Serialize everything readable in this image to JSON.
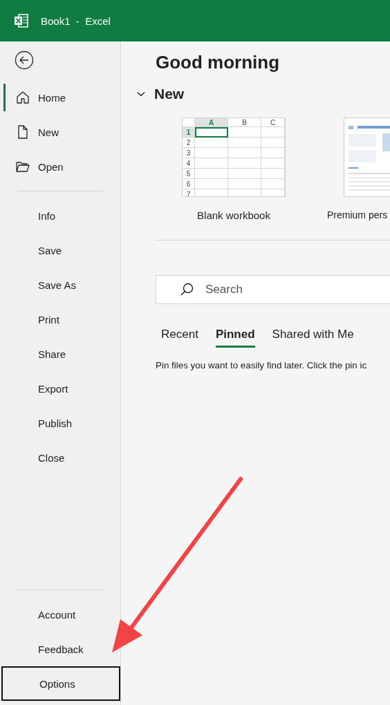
{
  "window": {
    "title": "Book1  -  Excel"
  },
  "sidebar": {
    "sections": [
      {
        "items": [
          {
            "label": "Home",
            "selected": true
          },
          {
            "label": "New",
            "selected": false
          },
          {
            "label": "Open",
            "selected": false
          }
        ]
      },
      {
        "items": [
          {
            "label": "Info",
            "selected": false
          },
          {
            "label": "Save",
            "selected": false
          },
          {
            "label": "Save As",
            "selected": false
          },
          {
            "label": "Print",
            "selected": false
          },
          {
            "label": "Share",
            "selected": false
          },
          {
            "label": "Export",
            "selected": false
          },
          {
            "label": "Publish",
            "selected": false
          },
          {
            "label": "Close",
            "selected": false
          }
        ]
      },
      {
        "items": [
          {
            "label": "Account",
            "selected": false
          },
          {
            "label": "Feedback",
            "selected": false
          },
          {
            "label": "Options",
            "selected": false,
            "outlined": true
          }
        ]
      }
    ]
  },
  "greeting": "Good morning",
  "new_section": {
    "title": "New",
    "expanded": true,
    "templates": [
      {
        "kind": "blank",
        "label": "Blank workbook",
        "columns": [
          "A",
          "B",
          "C"
        ],
        "rows": [
          "1",
          "2",
          "3",
          "4",
          "5",
          "6",
          "7"
        ]
      },
      {
        "kind": "preview",
        "label": "Premium pers"
      }
    ]
  },
  "search": {
    "placeholder": "Search"
  },
  "tabs": [
    {
      "label": "Recent",
      "selected": false
    },
    {
      "label": "Pinned",
      "selected": true
    },
    {
      "label": "Shared with Me",
      "selected": false
    }
  ],
  "empty_message": "Pin files you want to easily find later. Click the pin ic",
  "annotation": {
    "kind": "arrow"
  }
}
